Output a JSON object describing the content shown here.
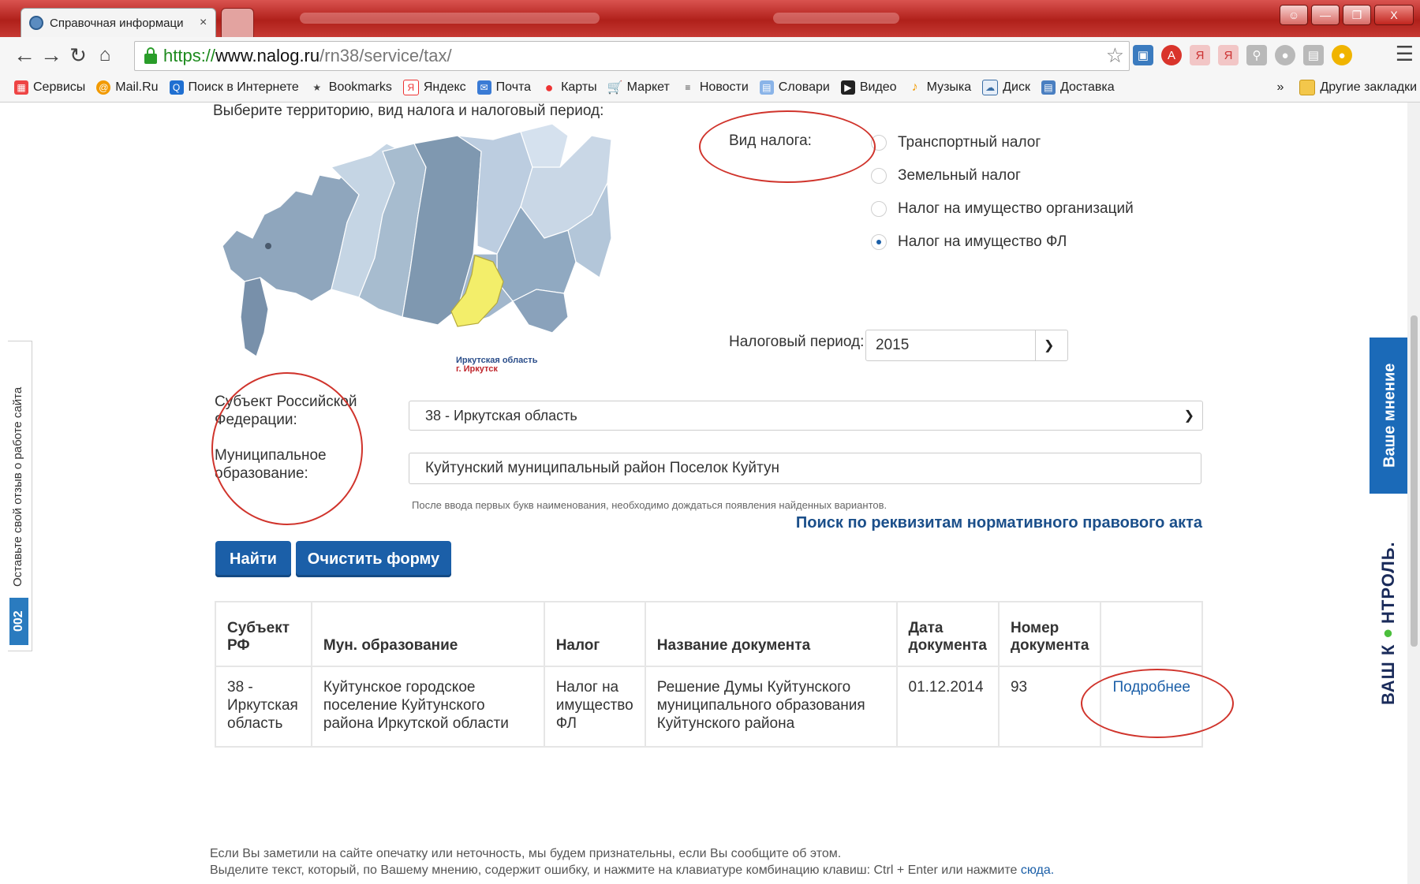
{
  "browser": {
    "tab_title": "Справочная информаци",
    "tab_close": "×",
    "url_scheme": "https://",
    "url_host": "www.nalog.ru",
    "url_path": "/rn38/service/tax/",
    "window_controls": [
      "—",
      "❐",
      "X"
    ]
  },
  "bookmarks": {
    "items": [
      "Сервисы",
      "Mail.Ru",
      "Поиск в Интернете",
      "Bookmarks",
      "Яндекс",
      "Почта",
      "Карты",
      "Маркет",
      "Новости",
      "Словари",
      "Видео",
      "Музыка",
      "Диск",
      "Доставка"
    ],
    "more": "»",
    "other": "Другие закладки"
  },
  "page": {
    "intro": "Выберите территорию, вид налога и налоговый период:",
    "map_region": "Иркутская область",
    "map_city": "г. Иркутск",
    "tax_type_label": "Вид налога:",
    "tax_types": [
      {
        "label": "Транспортный налог",
        "checked": false
      },
      {
        "label": "Земельный налог",
        "checked": false
      },
      {
        "label": "Налог на имущество организаций",
        "checked": false
      },
      {
        "label": "Налог на имущество ФЛ",
        "checked": true
      }
    ],
    "period_label": "Налоговый период:",
    "period_value": "2015",
    "subject_label": "Субъект Российской Федерации:",
    "subject_value": "38 - Иркутская область",
    "municipality_label": "Муниципальное образование:",
    "municipality_value": "Куйтунский муниципальный район Поселок Куйтун",
    "hint": "После ввода первых букв наименования, необходимо дождаться появления найденных вариантов.",
    "requisites_link": "Поиск по реквизитам нормативного правового акта",
    "find_button": "Найти",
    "clear_button": "Очистить форму"
  },
  "results": {
    "headers": [
      "Субъект РФ",
      "Мун. образование",
      "Налог",
      "Название документа",
      "Дата документа",
      "Номер документа"
    ],
    "rows": [
      {
        "subject": "38 - Иркутская область",
        "municipality": "Куйтунское городское поселение Куйтунского района Иркутской области",
        "tax": "Налог на имущество ФЛ",
        "document": "Решение Думы Куйтунского муниципального образования Куйтунского района",
        "date": "01.12.2014",
        "number": "93",
        "more": "Подробнее"
      }
    ]
  },
  "footer": {
    "line1": "Если Вы заметили на сайте опечатку или неточность, мы будем признательны, если Вы сообщите об этом.",
    "line2": "Выделите текст, который, по Вашему мнению, содержит ошибку, и нажмите на клавиатуре комбинацию клавиш: Ctrl + Enter или нажмите",
    "link": "сюда."
  },
  "side": {
    "feedback": "Оставьте свой отзыв о работе сайта",
    "badge": "002",
    "opinion": "Ваше мнение",
    "kontrol_a": "ВАШ К",
    "kontrol_dot": "●",
    "kontrol_b": "НТРОЛЬ."
  },
  "colors": {
    "accent": "#1b5fa8",
    "annotation": "#d0342c",
    "map_highlight": "#f3ee6a"
  }
}
